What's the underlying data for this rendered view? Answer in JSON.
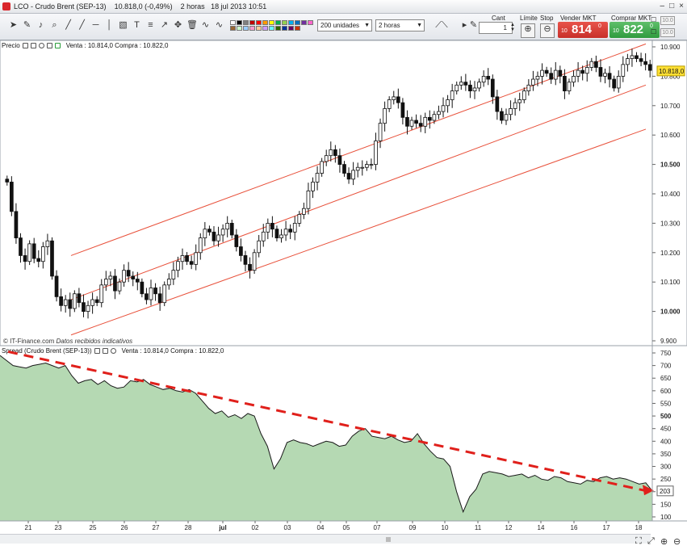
{
  "window": {
    "title": "LCO - Crudo Brent (SEP-13)",
    "price": "10.818,0 (-0,49%)",
    "period": "2 horas",
    "datetime": "18 jul 2013 10:51",
    "minimize": "–",
    "maximize": "□",
    "close": "×"
  },
  "toolbar": {
    "units_select": "200 unidades",
    "period_select": "2 horas",
    "cant_label": "Cant",
    "cant_value": "1",
    "limit_label": "Límite",
    "stop_label": "Stop",
    "sell_label": "Vender MKT",
    "buy_label": "Comprar MKT",
    "sell_prefix": "10",
    "sell_price": "814",
    "sell_sup": "0",
    "buy_prefix": "10",
    "buy_price": "822",
    "buy_sup": "0",
    "s_label": "S",
    "l_label": "L",
    "s_value": "10.0",
    "l_value": "10.0",
    "colors": [
      "#ffffff",
      "#000000",
      "#7f7f7f",
      "#c00000",
      "#ff0000",
      "#ff9900",
      "#ffff00",
      "#00b050",
      "#92d050",
      "#00b0f0",
      "#0070c0",
      "#7030a0",
      "#ff66cc",
      "#996633",
      "#ccffcc",
      "#99ccff",
      "#ff99cc",
      "#ffcc99",
      "#cc99ff",
      "#66ffff",
      "#336600",
      "#003399",
      "#660066",
      "#cc3300"
    ]
  },
  "price_panel": {
    "label": "Precio",
    "quote": "Venta : 10.814,0 Compra : 10.822,0",
    "credit_prefix": "© IT-Finance.com ",
    "credit_note": "Datos recibidos indicativos",
    "last_label": "10.818,0"
  },
  "spread_panel": {
    "label": "Spread (Crudo Brent (SEP-13))",
    "quote": "Venta : 10.814,0 Compra : 10.822,0",
    "last_label": "203"
  },
  "x_axis_labels": [
    "21",
    "23",
    "25",
    "26",
    "27",
    "28",
    "jul",
    "02",
    "03",
    "04",
    "05",
    "07",
    "09",
    "10",
    "11",
    "12",
    "14",
    "16",
    "17",
    "18"
  ],
  "chart_data": [
    {
      "type": "candlestick",
      "title": "",
      "ylabel": "",
      "ylim": [
        9.9,
        10.92
      ],
      "yticks": [
        "10.900",
        "10.800",
        "10.700",
        "10.600",
        "10.500",
        "10.400",
        "10.300",
        "10.200",
        "10.100",
        "10.000",
        "9.900"
      ],
      "bold_ticks": [
        "10.500",
        "10.000"
      ],
      "closes": [
        10.44,
        10.34,
        10.25,
        10.19,
        10.17,
        10.23,
        10.18,
        10.17,
        10.22,
        10.24,
        10.12,
        10.05,
        10.02,
        10.04,
        10.01,
        10.06,
        10.03,
        10.0,
        10.02,
        10.04,
        10.03,
        10.09,
        10.11,
        10.12,
        10.07,
        10.1,
        10.14,
        10.12,
        10.11,
        10.1,
        10.06,
        10.04,
        10.08,
        10.06,
        10.03,
        10.09,
        10.11,
        10.14,
        10.17,
        10.19,
        10.17,
        10.16,
        10.2,
        10.25,
        10.28,
        10.27,
        10.24,
        10.26,
        10.28,
        10.3,
        10.26,
        10.22,
        10.19,
        10.16,
        10.14,
        10.2,
        10.24,
        10.27,
        10.3,
        10.28,
        10.25,
        10.26,
        10.28,
        10.27,
        10.3,
        10.33,
        10.35,
        10.41,
        10.44,
        10.47,
        10.51,
        10.53,
        10.55,
        10.53,
        10.5,
        10.47,
        10.45,
        10.48,
        10.49,
        10.49,
        10.5,
        10.5,
        10.58,
        10.64,
        10.69,
        10.72,
        10.73,
        10.71,
        10.66,
        10.63,
        10.65,
        10.64,
        10.63,
        10.66,
        10.65,
        10.67,
        10.68,
        10.7,
        10.72,
        10.75,
        10.77,
        10.78,
        10.77,
        10.75,
        10.76,
        10.78,
        10.8,
        10.79,
        10.73,
        10.68,
        10.65,
        10.67,
        10.69,
        10.71,
        10.72,
        10.75,
        10.77,
        10.79,
        10.8,
        10.82,
        10.81,
        10.79,
        10.82,
        10.8,
        10.75,
        10.78,
        10.8,
        10.82,
        10.81,
        10.83,
        10.85,
        10.83,
        10.8,
        10.81,
        10.79,
        10.76,
        10.8,
        10.84,
        10.86,
        10.87,
        10.86,
        10.85,
        10.84,
        10.82
      ],
      "channel": {
        "upper": [
          [
            10.19,
            10.91
          ]
        ],
        "middle": [
          [
            10.04,
            10.77
          ]
        ],
        "lower": [
          [
            9.92,
            10.62
          ]
        ],
        "color": "#e8503a"
      },
      "last": 10.818
    },
    {
      "type": "area",
      "title": "",
      "ylim": [
        100,
        760
      ],
      "yticks": [
        "750",
        "700",
        "650",
        "600",
        "550",
        "500",
        "450",
        "400",
        "350",
        "300",
        "250",
        "200",
        "150",
        "100"
      ],
      "bold_ticks": [
        "500"
      ],
      "values": [
        740,
        720,
        700,
        695,
        690,
        700,
        705,
        710,
        700,
        690,
        700,
        660,
        630,
        640,
        645,
        625,
        640,
        620,
        610,
        615,
        640,
        635,
        645,
        625,
        615,
        605,
        610,
        600,
        595,
        605,
        590,
        560,
        530,
        510,
        520,
        495,
        505,
        490,
        510,
        500,
        430,
        380,
        290,
        330,
        395,
        405,
        395,
        390,
        380,
        390,
        400,
        395,
        380,
        385,
        420,
        440,
        450,
        420,
        415,
        410,
        420,
        405,
        395,
        400,
        430,
        390,
        360,
        335,
        330,
        300,
        200,
        120,
        180,
        210,
        270,
        280,
        275,
        270,
        260,
        265,
        270,
        255,
        265,
        250,
        245,
        260,
        255,
        240,
        235,
        230,
        245,
        240,
        255,
        260,
        250,
        255,
        250,
        240,
        230,
        235,
        203
      ],
      "fill": "#b5d9b3",
      "trend_start": 755,
      "trend_end": 205,
      "trend_color": "#e0201b",
      "last": 203
    }
  ]
}
